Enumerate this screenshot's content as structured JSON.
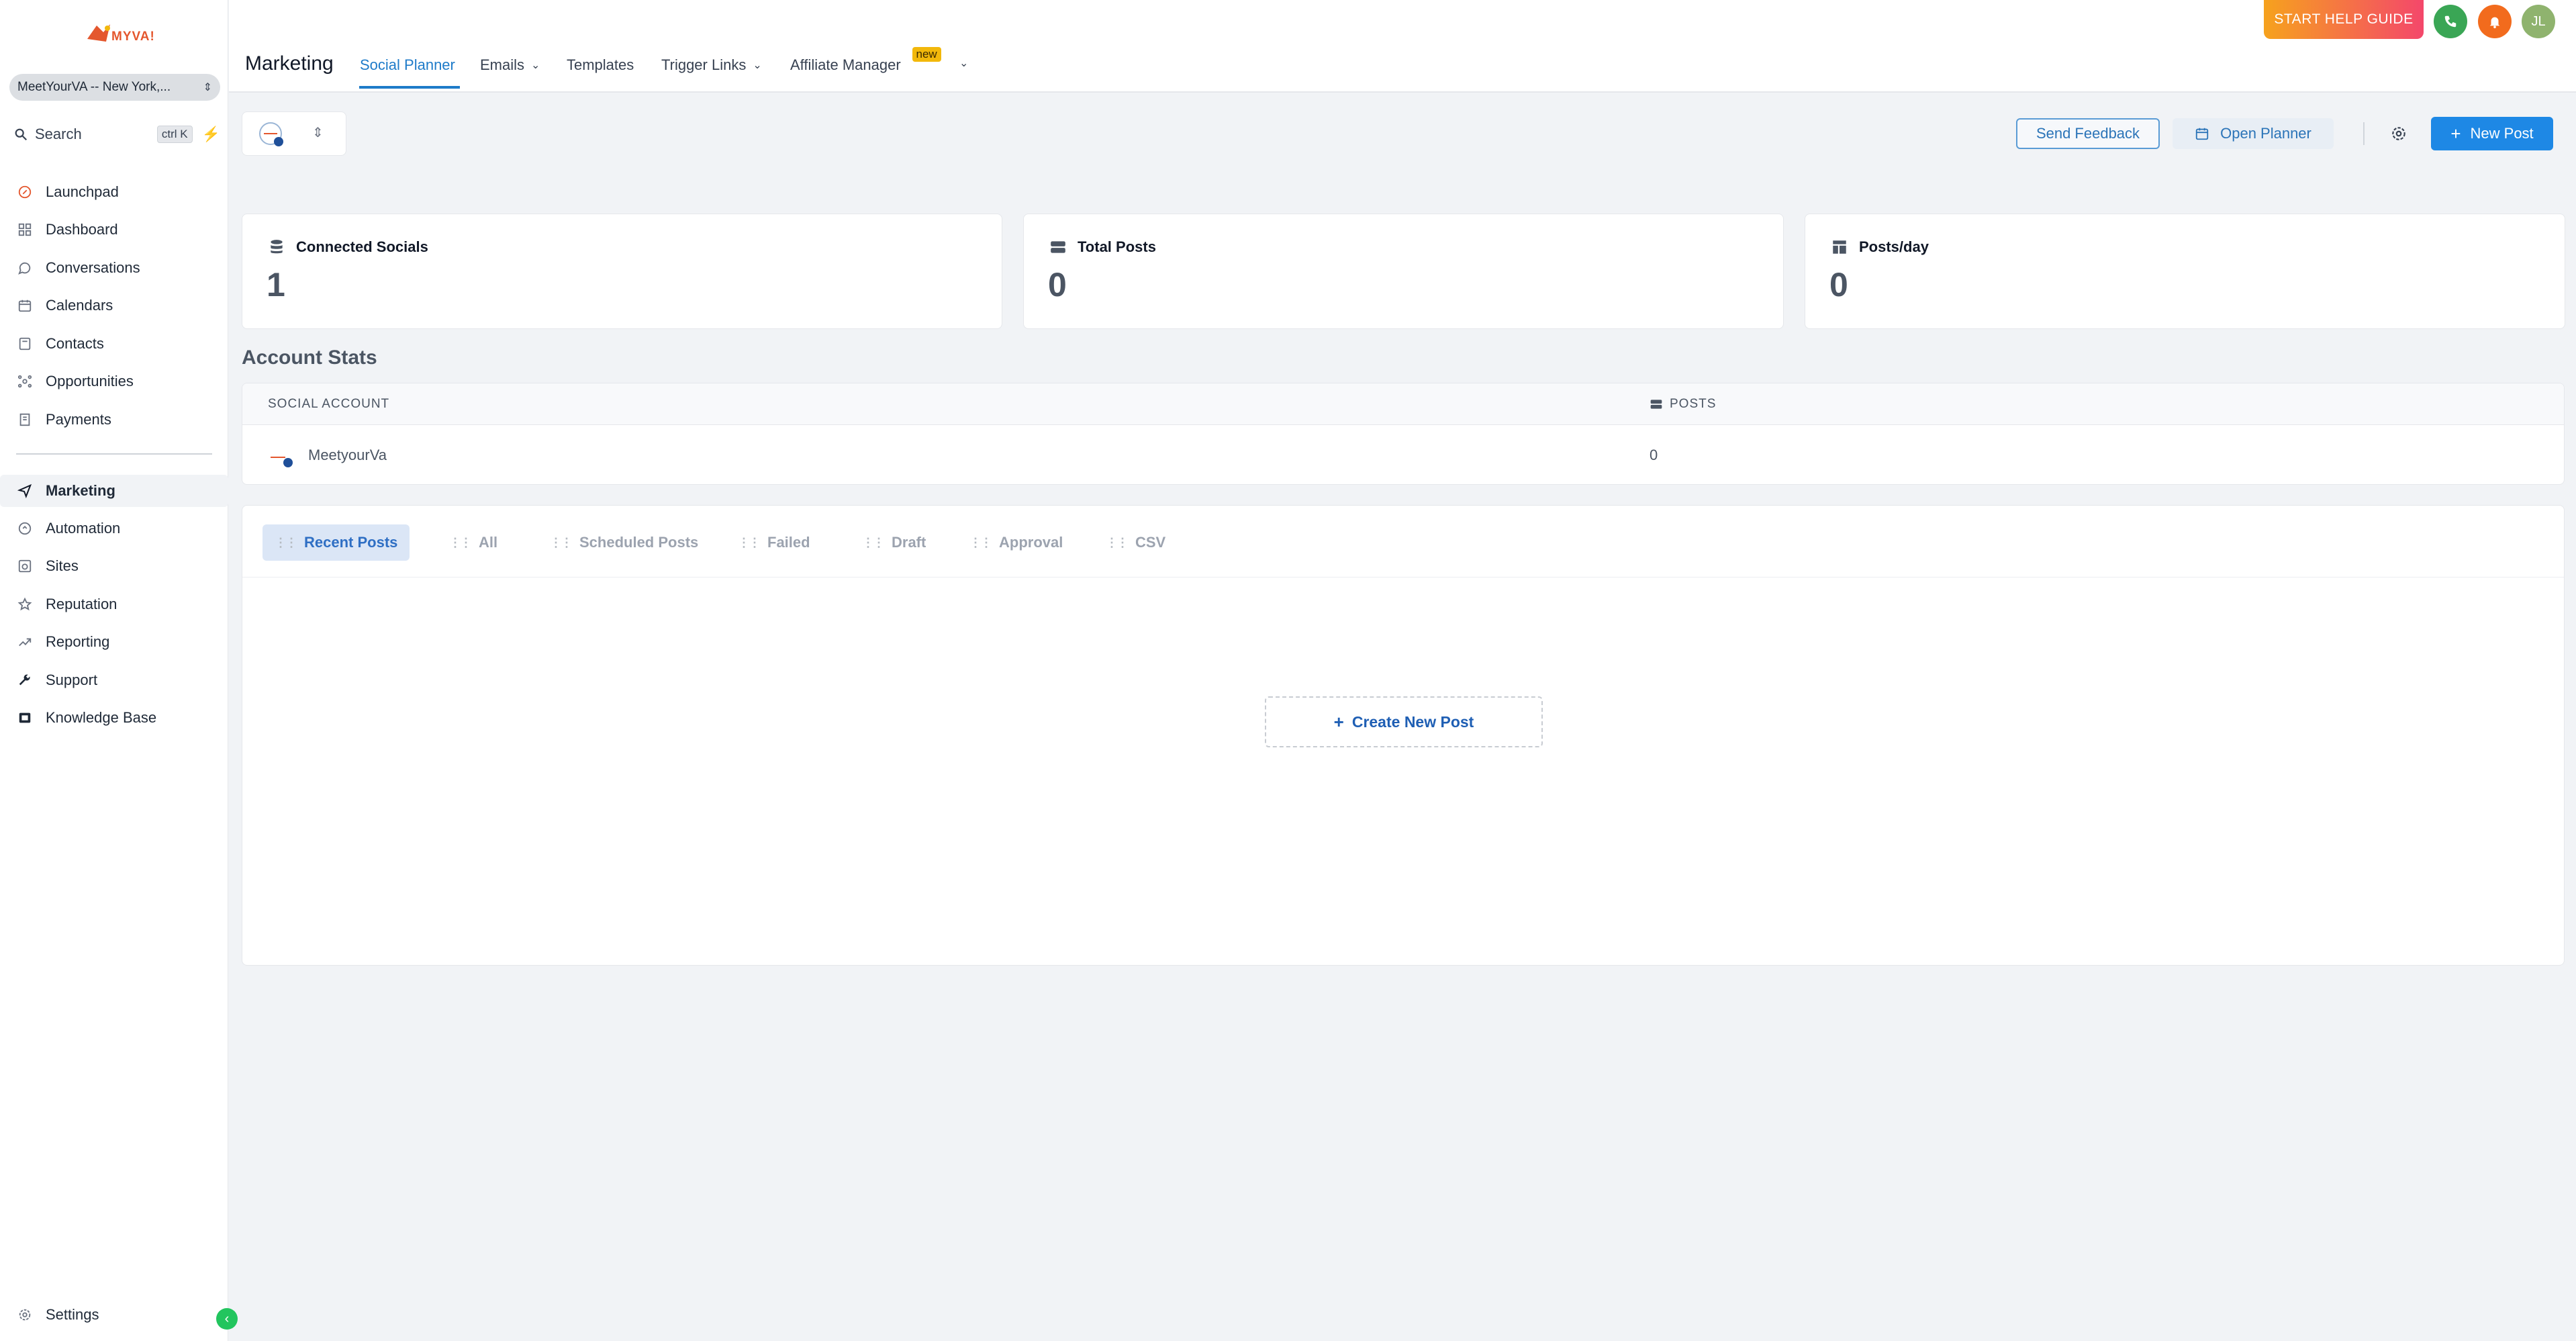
{
  "brand": {
    "logo_text": "MYVA!"
  },
  "sidebar": {
    "account": "MeetYourVA -- New York,...",
    "search_label": "Search",
    "search_shortcut": "ctrl K",
    "items": [
      {
        "label": "Launchpad",
        "icon": "rocket-icon"
      },
      {
        "label": "Dashboard",
        "icon": "grid-icon"
      },
      {
        "label": "Conversations",
        "icon": "chat-icon"
      },
      {
        "label": "Calendars",
        "icon": "calendar-icon"
      },
      {
        "label": "Contacts",
        "icon": "contacts-icon"
      },
      {
        "label": "Opportunities",
        "icon": "funnel-icon"
      },
      {
        "label": "Payments",
        "icon": "receipt-icon"
      },
      {
        "label": "Marketing",
        "icon": "send-icon",
        "active": true
      },
      {
        "label": "Automation",
        "icon": "automation-icon"
      },
      {
        "label": "Sites",
        "icon": "sites-icon"
      },
      {
        "label": "Reputation",
        "icon": "star-icon"
      },
      {
        "label": "Reporting",
        "icon": "trend-icon"
      },
      {
        "label": "Support",
        "icon": "wrench-icon"
      },
      {
        "label": "Knowledge Base",
        "icon": "book-icon"
      }
    ],
    "settings_label": "Settings"
  },
  "topbar": {
    "title": "Marketing",
    "tabs": [
      {
        "label": "Social Planner",
        "active": true
      },
      {
        "label": "Emails",
        "dropdown": true
      },
      {
        "label": "Templates"
      },
      {
        "label": "Trigger Links",
        "dropdown": true
      },
      {
        "label": "Affiliate Manager",
        "badge": "new"
      }
    ],
    "help_button": "START HELP GUIDE",
    "avatar_initials": "JL",
    "colors": {
      "phone": "#3aa655",
      "bell": "#f26b1d",
      "avatar": "#8fb36e"
    }
  },
  "toolbar": {
    "send_feedback": "Send Feedback",
    "open_planner": "Open Planner",
    "new_post": "New Post"
  },
  "stats": [
    {
      "label": "Connected Socials",
      "value": "1",
      "icon": "stack-icon"
    },
    {
      "label": "Total Posts",
      "value": "0",
      "icon": "server-icon"
    },
    {
      "label": "Posts/day",
      "value": "0",
      "icon": "layout-icon"
    }
  ],
  "account_stats": {
    "title": "Account Stats",
    "columns": [
      "SOCIAL ACCOUNT",
      "POSTS"
    ],
    "rows": [
      {
        "account": "MeetyourVa",
        "posts": "0"
      }
    ]
  },
  "posts_panel": {
    "tabs": [
      {
        "label": "Recent Posts",
        "active": true
      },
      {
        "label": "All"
      },
      {
        "label": "Scheduled Posts"
      },
      {
        "label": "Failed"
      },
      {
        "label": "Draft"
      },
      {
        "label": "Approval"
      },
      {
        "label": "CSV"
      }
    ],
    "create_button": "Create New Post"
  }
}
